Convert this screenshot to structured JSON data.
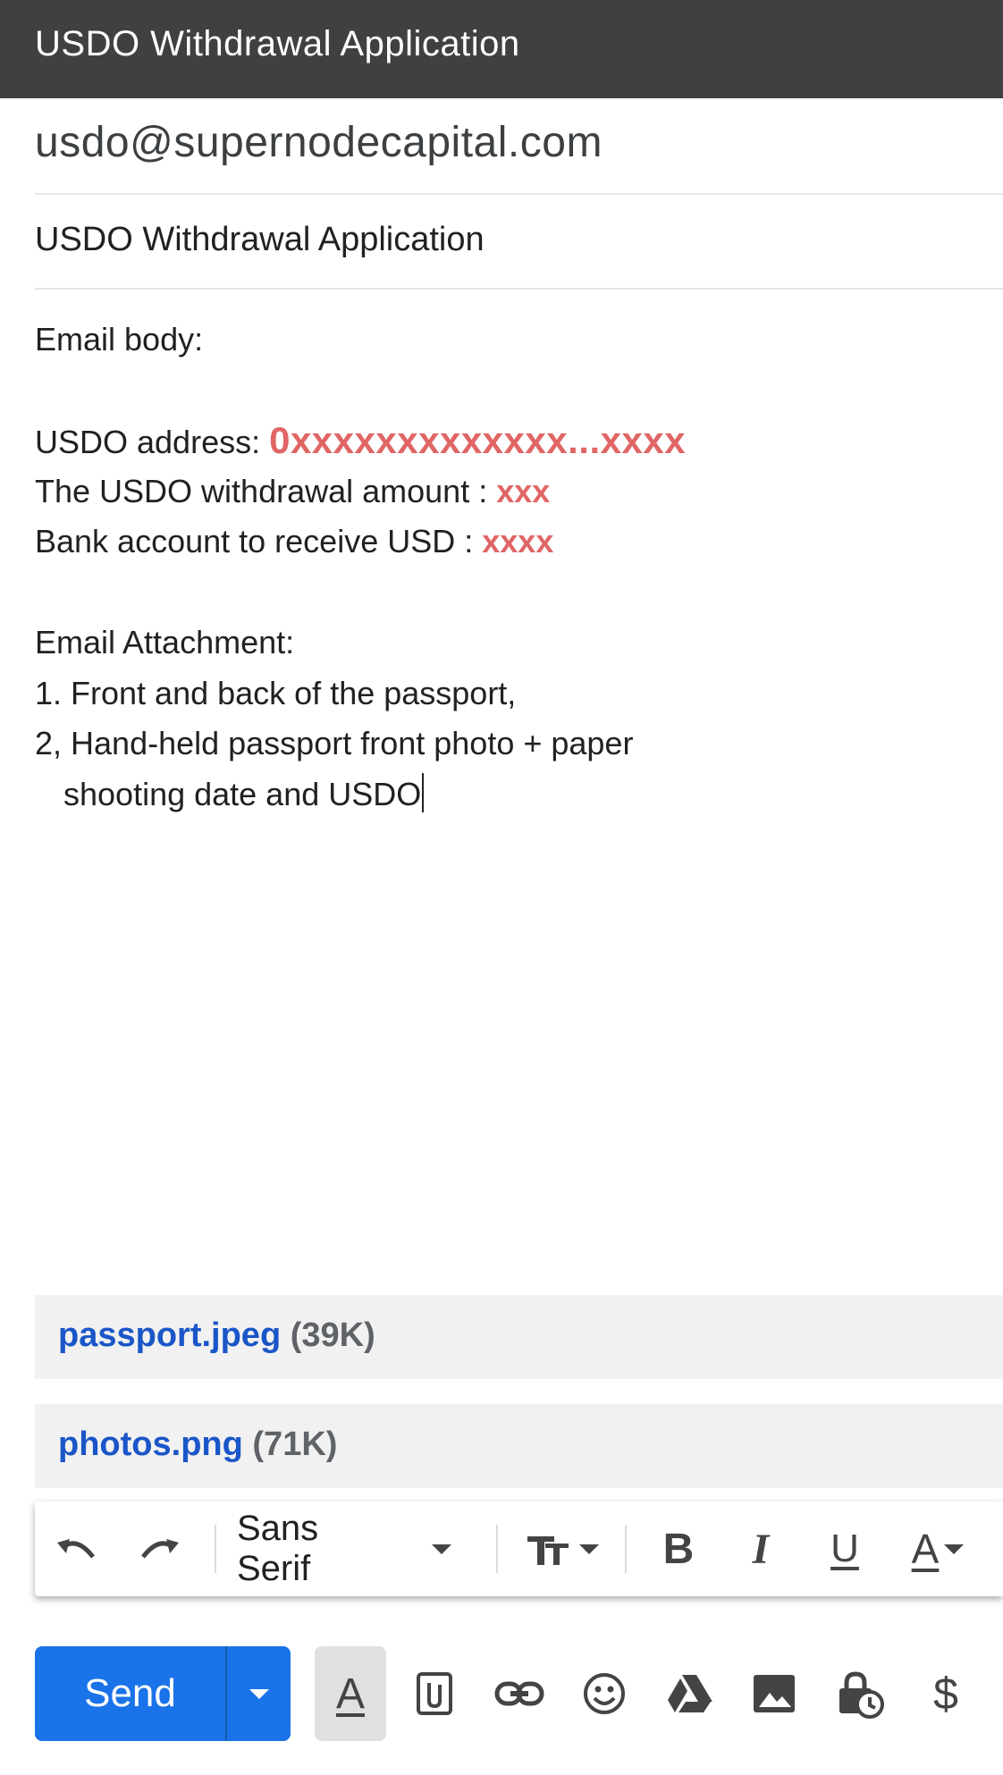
{
  "window": {
    "title": "USDO Withdrawal Application"
  },
  "compose": {
    "to": "usdo@supernodecapital.com",
    "subject": "USDO Withdrawal Application",
    "body": {
      "heading": "Email body:",
      "address_label": "USDO address: ",
      "address_value": "0xxxxxxxxxxxxx...xxxx",
      "amount_label": "The USDO withdrawal amount : ",
      "amount_value": "xxx",
      "bank_label": "Bank account to receive USD : ",
      "bank_value": "xxxx",
      "attachment_heading": "Email Attachment:",
      "item1": "1. Front and back of the passport,",
      "item2_line1": "2, Hand-held passport front photo + paper",
      "item2_line2": "shooting date and USDO"
    },
    "accent_color": "#e06666"
  },
  "attachments": [
    {
      "name": "passport.jpeg",
      "size": "(39K)"
    },
    {
      "name": "photos.png",
      "size": "(71K)"
    }
  ],
  "format_toolbar": {
    "font": "Sans Serif",
    "icons": [
      "undo-icon",
      "redo-icon",
      "font-size-icon",
      "bold-icon",
      "italic-icon",
      "underline-icon",
      "text-color-icon"
    ]
  },
  "bottom_bar": {
    "send_label": "Send",
    "send_color": "#1a73e8",
    "icons": [
      "formatting-icon",
      "attach-icon",
      "link-icon",
      "emoji-icon",
      "drive-icon",
      "photo-icon",
      "confidential-icon",
      "money-icon"
    ]
  }
}
